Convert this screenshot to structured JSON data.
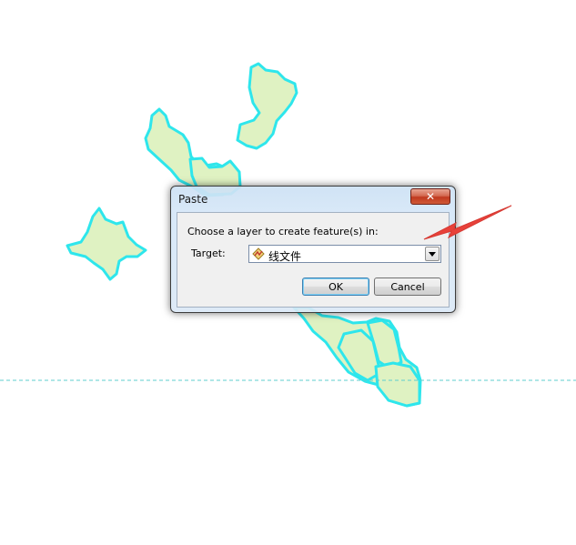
{
  "dialog": {
    "title": "Paste",
    "close_symbol": "✕",
    "prompt": "Choose a layer to create feature(s) in:",
    "target_label": "Target:",
    "target_value": "线文件",
    "target_icon": "line-layer-icon",
    "ok_label": "OK",
    "cancel_label": "Cancel"
  },
  "colors": {
    "polygon_fill": "#dff2c2",
    "polygon_outline": "#2ee6ec",
    "annotation_arrow": "#e8413a",
    "close_button": "#c9442a"
  }
}
